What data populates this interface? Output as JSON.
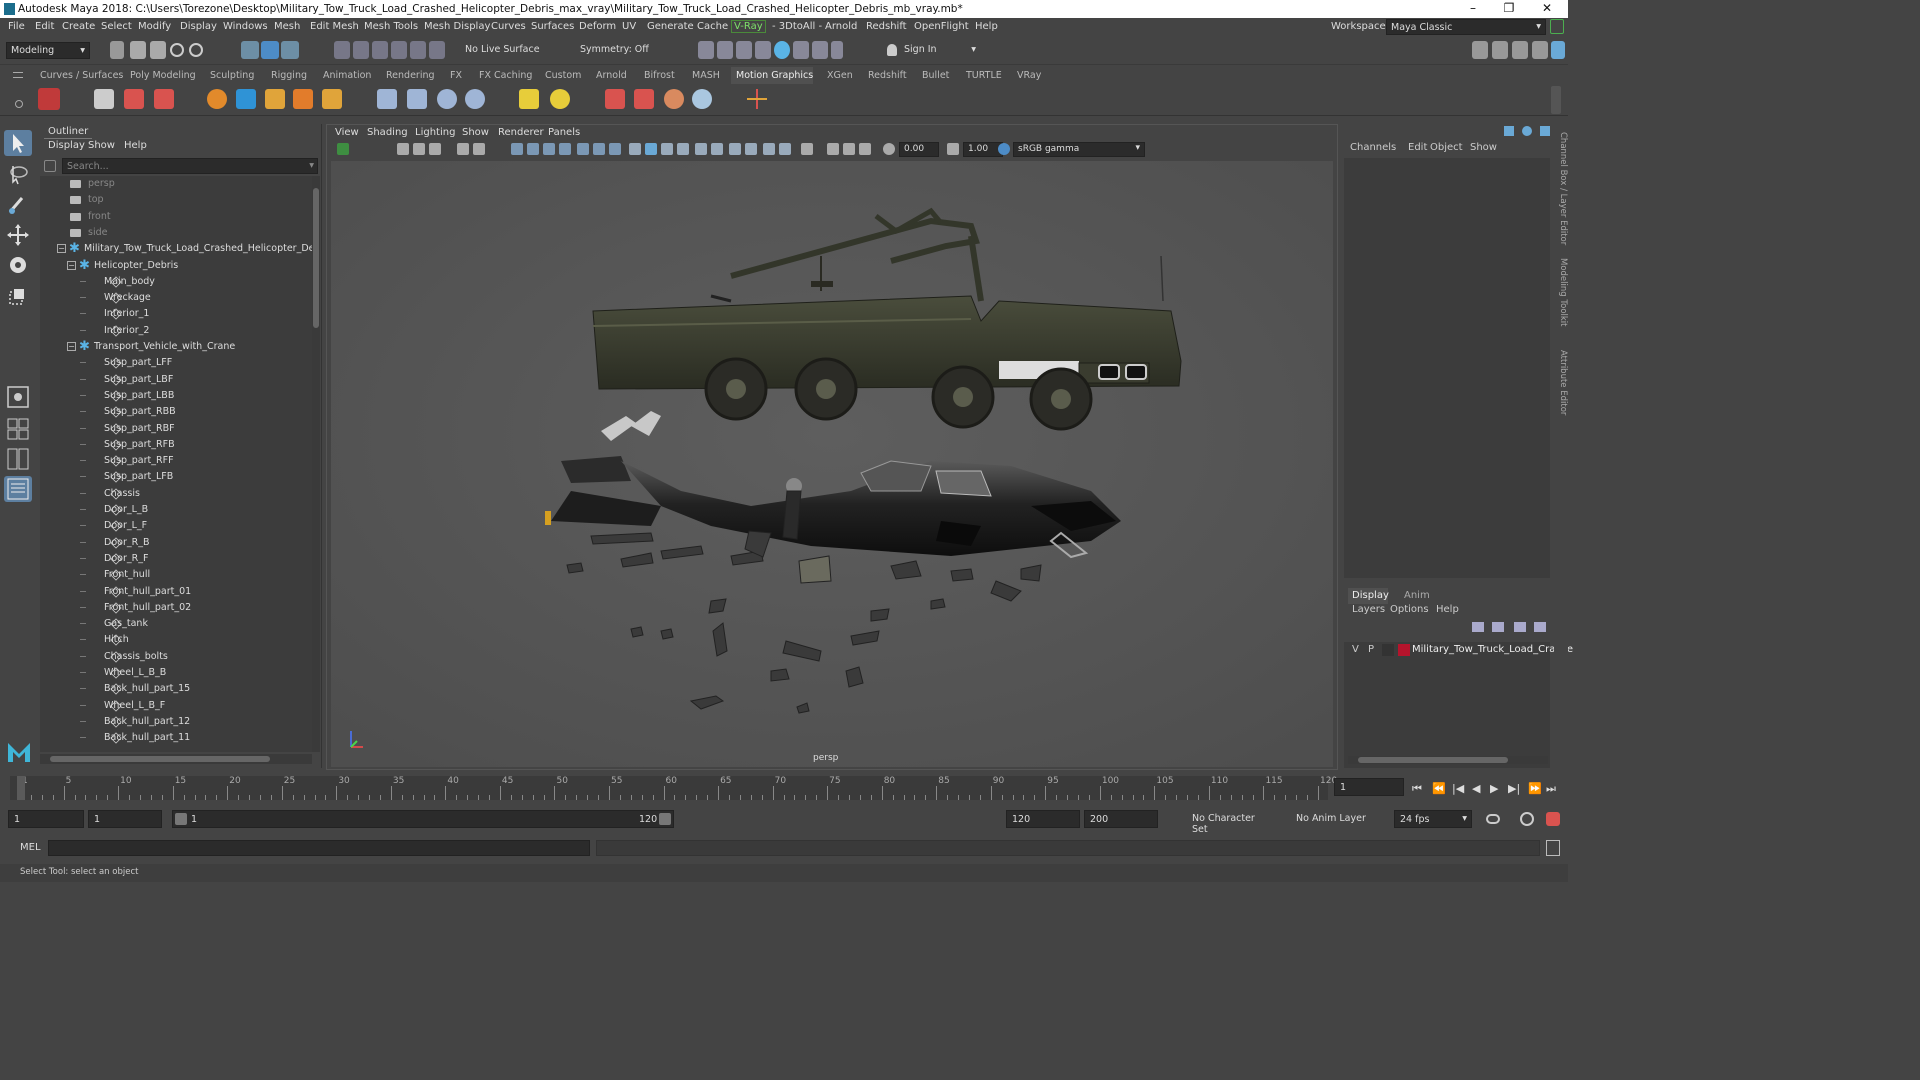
{
  "window": {
    "title": "Autodesk Maya 2018: C:\\Users\\Torezone\\Desktop\\Military_Tow_Truck_Load_Crashed_Helicopter_Debris_max_vray\\Military_Tow_Truck_Load_Crashed_Helicopter_Debris_mb_vray.mb*",
    "minimize": "–",
    "maximize": "❐",
    "close": "✕"
  },
  "menubar": [
    "File",
    "Edit",
    "Create",
    "Select",
    "Modify",
    "Display",
    "Windows",
    "Mesh",
    "Edit Mesh",
    "Mesh Tools",
    "Mesh Display",
    "Curves",
    "Surfaces",
    "Deform",
    "UV",
    "Generate",
    "Cache",
    "V-Ray",
    "- 3DtoAll -",
    "Arnold",
    "Redshift",
    "OpenFlight",
    "Help"
  ],
  "workspace": {
    "label": "Workspace :",
    "value": "Maya Classic"
  },
  "statusline": {
    "mode": "Modeling",
    "live_surface": "No Live Surface",
    "symmetry": "Symmetry: Off",
    "sign_in": "Sign In"
  },
  "shelf_tabs": [
    "Curves / Surfaces",
    "Poly Modeling",
    "Sculpting",
    "Rigging",
    "Animation",
    "Rendering",
    "FX",
    "FX Caching",
    "Custom",
    "Arnold",
    "Bifrost",
    "MASH",
    "Motion Graphics",
    "XGen",
    "Redshift",
    "Bullet",
    "TURTLE",
    "VRay"
  ],
  "shelf_active": "Motion Graphics",
  "outliner": {
    "title": "Outliner",
    "menu": [
      "Display",
      "Show",
      "Help"
    ],
    "search_placeholder": "Search...",
    "items": [
      {
        "label": "persp",
        "type": "camera",
        "level": 0,
        "dim": true
      },
      {
        "label": "top",
        "type": "camera",
        "level": 0,
        "dim": true
      },
      {
        "label": "front",
        "type": "camera",
        "level": 0,
        "dim": true
      },
      {
        "label": "side",
        "type": "camera",
        "level": 0,
        "dim": true
      },
      {
        "label": "Military_Tow_Truck_Load_Crashed_Helicopter_Debris_",
        "type": "group",
        "level": 0
      },
      {
        "label": "Helicopter_Debris",
        "type": "group",
        "level": 1
      },
      {
        "label": "Main_body",
        "type": "mesh",
        "level": 2
      },
      {
        "label": "Wreckage",
        "type": "mesh",
        "level": 2
      },
      {
        "label": "Interior_1",
        "type": "mesh",
        "level": 2
      },
      {
        "label": "Interior_2",
        "type": "mesh",
        "level": 2
      },
      {
        "label": "Transport_Vehicle_with_Crane",
        "type": "group",
        "level": 1
      },
      {
        "label": "Susp_part_LFF",
        "type": "mesh",
        "level": 2
      },
      {
        "label": "Susp_part_LBF",
        "type": "mesh",
        "level": 2
      },
      {
        "label": "Susp_part_LBB",
        "type": "mesh",
        "level": 2
      },
      {
        "label": "Susp_part_RBB",
        "type": "mesh",
        "level": 2
      },
      {
        "label": "Susp_part_RBF",
        "type": "mesh",
        "level": 2
      },
      {
        "label": "Susp_part_RFB",
        "type": "mesh",
        "level": 2
      },
      {
        "label": "Susp_part_RFF",
        "type": "mesh",
        "level": 2
      },
      {
        "label": "Susp_part_LFB",
        "type": "mesh",
        "level": 2
      },
      {
        "label": "Chassis",
        "type": "mesh",
        "level": 2
      },
      {
        "label": "Door_L_B",
        "type": "mesh",
        "level": 2
      },
      {
        "label": "Door_L_F",
        "type": "mesh",
        "level": 2
      },
      {
        "label": "Door_R_B",
        "type": "mesh",
        "level": 2
      },
      {
        "label": "Door_R_F",
        "type": "mesh",
        "level": 2
      },
      {
        "label": "Front_hull",
        "type": "mesh",
        "level": 2
      },
      {
        "label": "Front_hull_part_01",
        "type": "mesh",
        "level": 2
      },
      {
        "label": "Front_hull_part_02",
        "type": "mesh",
        "level": 2
      },
      {
        "label": "Gas_tank",
        "type": "mesh",
        "level": 2
      },
      {
        "label": "Hitch",
        "type": "mesh",
        "level": 2
      },
      {
        "label": "Chassis_bolts",
        "type": "mesh",
        "level": 2
      },
      {
        "label": "Wheel_L_B_B",
        "type": "mesh",
        "level": 2
      },
      {
        "label": "Back_hull_part_15",
        "type": "mesh",
        "level": 2
      },
      {
        "label": "Wheel_L_B_F",
        "type": "mesh",
        "level": 2
      },
      {
        "label": "Back_hull_part_12",
        "type": "mesh",
        "level": 2
      },
      {
        "label": "Back_hull_part_11",
        "type": "mesh",
        "level": 2
      }
    ]
  },
  "viewport": {
    "menu": [
      "View",
      "Shading",
      "Lighting",
      "Show",
      "Renderer",
      "Panels"
    ],
    "exposure": "0.00",
    "gamma": "1.00",
    "color_space": "sRGB gamma",
    "camera_label": "persp"
  },
  "channelbox": {
    "menu": [
      "Channels",
      "Edit",
      "Object",
      "Show"
    ]
  },
  "layers": {
    "tabs": [
      "Display",
      "Anim"
    ],
    "menu": [
      "Layers",
      "Options",
      "Help"
    ],
    "row": {
      "v": "V",
      "p": "P",
      "name": "Military_Tow_Truck_Load_Crashe",
      "color": "#b5142c"
    }
  },
  "side_tabs": [
    "Channel Box / Layer Editor",
    "Modeling Toolkit",
    "Attribute Editor"
  ],
  "timeline": {
    "ticks": [
      "1",
      "5",
      "10",
      "15",
      "20",
      "25",
      "30",
      "35",
      "40",
      "45",
      "50",
      "55",
      "60",
      "65",
      "70",
      "75",
      "80",
      "85",
      "90",
      "95",
      "100",
      "105",
      "110",
      "115",
      "120"
    ],
    "current_frame": "1"
  },
  "range": {
    "start": "1",
    "playback_start": "1",
    "slider_start": "1",
    "slider_end": "120",
    "playback_end": "120",
    "end": "200",
    "character_set": "No Character Set",
    "anim_layer": "No Anim Layer",
    "fps": "24 fps"
  },
  "command_line": {
    "label": "MEL"
  },
  "help_line": "Select Tool: select an object"
}
